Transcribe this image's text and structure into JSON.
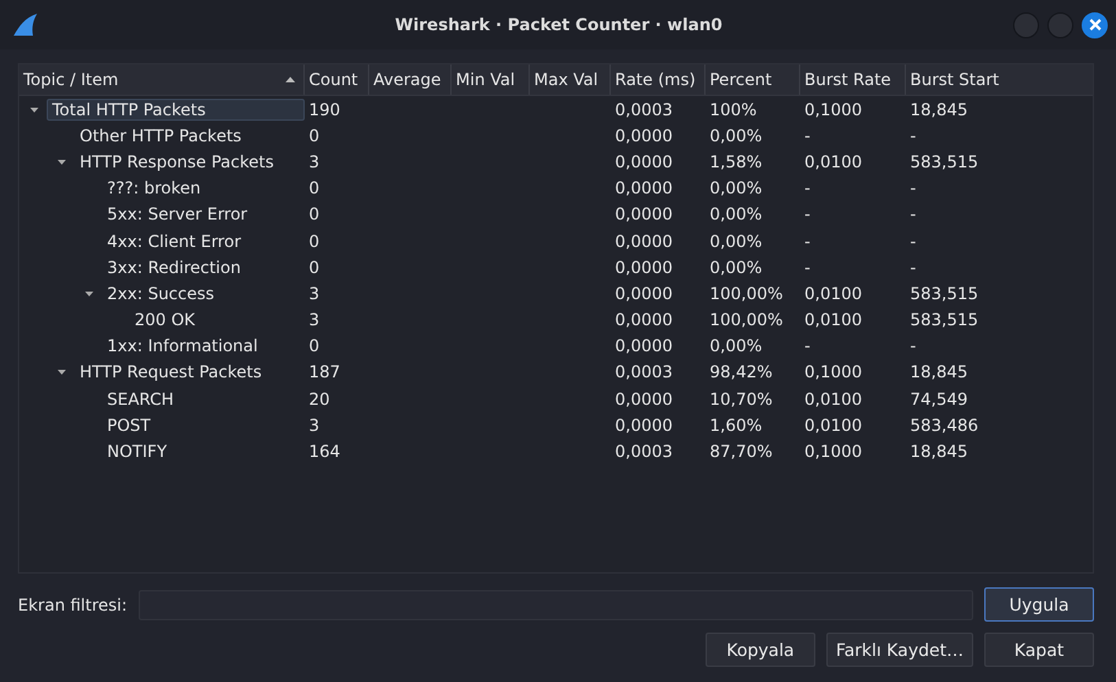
{
  "window": {
    "title": "Wireshark · Packet Counter · wlan0"
  },
  "table": {
    "columns": [
      {
        "label": "Topic / Item",
        "sorted": true
      },
      {
        "label": "Count",
        "sorted": false
      },
      {
        "label": "Average",
        "sorted": false
      },
      {
        "label": "Min Val",
        "sorted": false
      },
      {
        "label": "Max Val",
        "sorted": false
      },
      {
        "label": "Rate (ms)",
        "sorted": false
      },
      {
        "label": "Percent",
        "sorted": false
      },
      {
        "label": "Burst Rate",
        "sorted": false
      },
      {
        "label": "Burst Start",
        "sorted": false
      }
    ],
    "rows": [
      {
        "item": "Total HTTP Packets",
        "count": "190",
        "rate": "0,0003",
        "percent": "100%",
        "burst_rate": "0,1000",
        "burst_start": "18,845",
        "selected": true,
        "expanded": true,
        "children": [
          {
            "item": "Other HTTP Packets",
            "count": "0",
            "rate": "0,0000",
            "percent": "0,00%",
            "burst_rate": "-",
            "burst_start": "-",
            "selected": false
          },
          {
            "item": "HTTP Response Packets",
            "count": "3",
            "rate": "0,0000",
            "percent": "1,58%",
            "burst_rate": "0,0100",
            "burst_start": "583,515",
            "selected": false,
            "expanded": true,
            "children": [
              {
                "item": "???: broken",
                "count": "0",
                "rate": "0,0000",
                "percent": "0,00%",
                "burst_rate": "-",
                "burst_start": "-",
                "selected": false
              },
              {
                "item": "5xx: Server Error",
                "count": "0",
                "rate": "0,0000",
                "percent": "0,00%",
                "burst_rate": "-",
                "burst_start": "-",
                "selected": false
              },
              {
                "item": "4xx: Client Error",
                "count": "0",
                "rate": "0,0000",
                "percent": "0,00%",
                "burst_rate": "-",
                "burst_start": "-",
                "selected": false
              },
              {
                "item": "3xx: Redirection",
                "count": "0",
                "rate": "0,0000",
                "percent": "0,00%",
                "burst_rate": "-",
                "burst_start": "-",
                "selected": false
              },
              {
                "item": "2xx: Success",
                "count": "3",
                "rate": "0,0000",
                "percent": "100,00%",
                "burst_rate": "0,0100",
                "burst_start": "583,515",
                "selected": false,
                "expanded": true,
                "children": [
                  {
                    "item": "200 OK",
                    "count": "3",
                    "rate": "0,0000",
                    "percent": "100,00%",
                    "burst_rate": "0,0100",
                    "burst_start": "583,515",
                    "selected": false
                  }
                ]
              },
              {
                "item": "1xx: Informational",
                "count": "0",
                "rate": "0,0000",
                "percent": "0,00%",
                "burst_rate": "-",
                "burst_start": "-",
                "selected": false
              }
            ]
          },
          {
            "item": "HTTP Request Packets",
            "count": "187",
            "rate": "0,0003",
            "percent": "98,42%",
            "burst_rate": "0,1000",
            "burst_start": "18,845",
            "selected": false,
            "expanded": true,
            "children": [
              {
                "item": "SEARCH",
                "count": "20",
                "rate": "0,0000",
                "percent": "10,70%",
                "burst_rate": "0,0100",
                "burst_start": "74,549",
                "selected": false
              },
              {
                "item": "POST",
                "count": "3",
                "rate": "0,0000",
                "percent": "1,60%",
                "burst_rate": "0,0100",
                "burst_start": "583,486",
                "selected": false
              },
              {
                "item": "NOTIFY",
                "count": "164",
                "rate": "0,0003",
                "percent": "87,70%",
                "burst_rate": "0,1000",
                "burst_start": "18,845",
                "selected": false
              }
            ]
          }
        ]
      }
    ]
  },
  "filter": {
    "label": "Ekran filtresi:",
    "apply_button": {
      "label": "Uygula",
      "focused": true
    }
  },
  "buttons": [
    {
      "label": "Kopyala",
      "focused": false
    },
    {
      "label": "Farklı Kaydet…",
      "focused": false
    },
    {
      "label": "Kapat",
      "focused": false
    }
  ]
}
